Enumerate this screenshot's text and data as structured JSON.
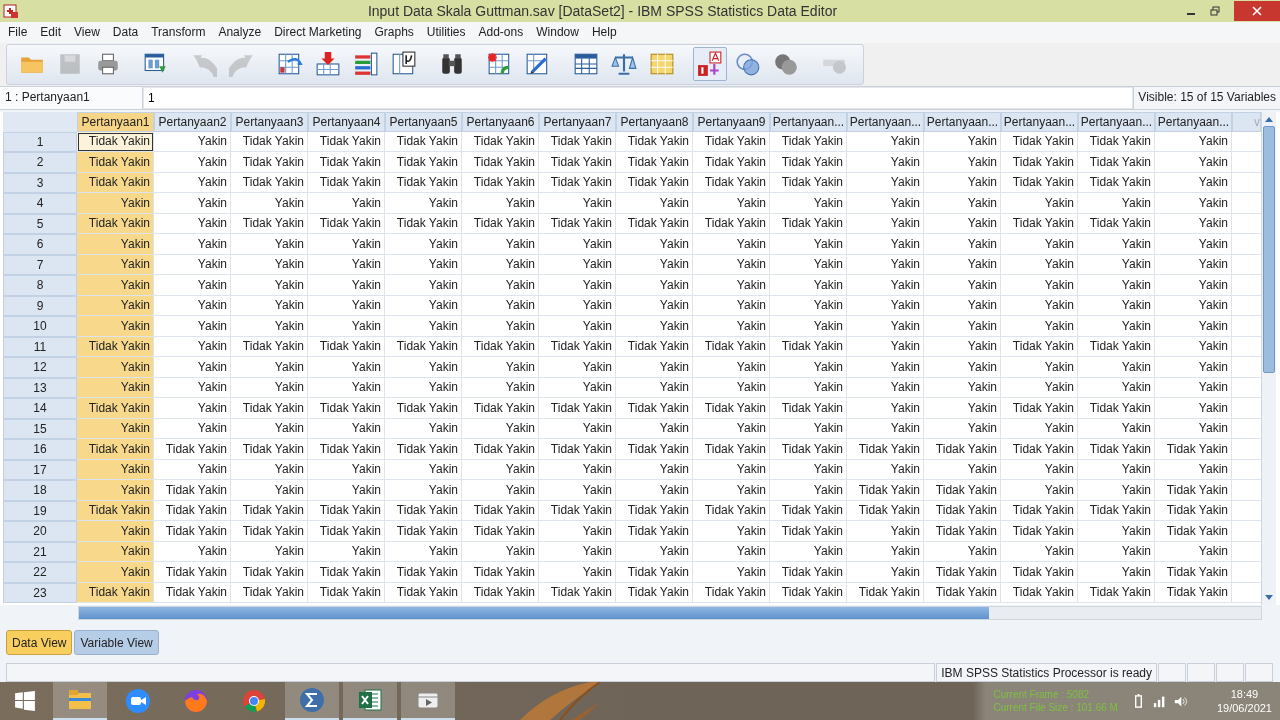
{
  "window": {
    "title": "Input Data Skala Guttman.sav [DataSet2] - IBM SPSS Statistics Data Editor"
  },
  "menu": [
    "File",
    "Edit",
    "View",
    "Data",
    "Transform",
    "Analyze",
    "Direct Marketing",
    "Graphs",
    "Utilities",
    "Add-ons",
    "Window",
    "Help"
  ],
  "toolbar": [
    {
      "disabled": false,
      "pressed": false
    },
    {
      "disabled": true,
      "pressed": false
    },
    {
      "disabled": false,
      "pressed": false
    },
    {
      "disabled": false,
      "pressed": false
    },
    {
      "disabled": true,
      "pressed": false
    },
    {
      "disabled": true,
      "pressed": false
    },
    {
      "disabled": false,
      "pressed": false
    },
    {
      "disabled": false,
      "pressed": false
    },
    {
      "disabled": false,
      "pressed": false
    },
    {
      "disabled": false,
      "pressed": false
    },
    {
      "disabled": false,
      "pressed": false
    },
    {
      "disabled": false,
      "pressed": false
    },
    {
      "disabled": false,
      "pressed": false
    },
    {
      "disabled": false,
      "pressed": false
    },
    {
      "disabled": false,
      "pressed": false
    },
    {
      "disabled": false,
      "pressed": false
    },
    {
      "disabled": false,
      "pressed": true
    },
    {
      "disabled": false,
      "pressed": false
    },
    {
      "disabled": false,
      "pressed": false
    },
    {
      "disabled": true,
      "pressed": false
    }
  ],
  "cell_editor": {
    "cell": "1 : Pertanyaan1",
    "value": "1",
    "visible": "Visible: 15 of 15 Variables"
  },
  "table": {
    "columns": [
      {
        "label": "Pertanyaan1",
        "selected": true
      },
      {
        "label": "Pertanyaan2",
        "selected": false
      },
      {
        "label": "Pertanyaan3",
        "selected": false
      },
      {
        "label": "Pertanyaan4",
        "selected": false
      },
      {
        "label": "Pertanyaan5",
        "selected": false
      },
      {
        "label": "Pertanyaan6",
        "selected": false
      },
      {
        "label": "Pertanyaan7",
        "selected": false
      },
      {
        "label": "Pertanyaan8",
        "selected": false
      },
      {
        "label": "Pertanyaan9",
        "selected": false
      },
      {
        "label": "Pertanyaan...",
        "selected": false
      },
      {
        "label": "Pertanyaan...",
        "selected": false
      },
      {
        "label": "Pertanyaan...",
        "selected": false
      },
      {
        "label": "Pertanyaan...",
        "selected": false
      },
      {
        "label": "Pertanyaan...",
        "selected": false
      },
      {
        "label": "Pertanyaan...",
        "selected": false
      }
    ],
    "empty_column": "v",
    "rows": [
      {
        "case": "1",
        "current": true,
        "cells": [
          "Tidak Yakin",
          "Yakin",
          "Tidak Yakin",
          "Tidak Yakin",
          "Tidak Yakin",
          "Tidak Yakin",
          "Tidak Yakin",
          "Tidak Yakin",
          "Tidak Yakin",
          "Tidak Yakin",
          "Yakin",
          "Yakin",
          "Tidak Yakin",
          "Tidak Yakin",
          "Yakin"
        ]
      },
      {
        "case": "2",
        "current": false,
        "cells": [
          "Tidak Yakin",
          "Yakin",
          "Tidak Yakin",
          "Tidak Yakin",
          "Tidak Yakin",
          "Tidak Yakin",
          "Tidak Yakin",
          "Tidak Yakin",
          "Tidak Yakin",
          "Tidak Yakin",
          "Yakin",
          "Yakin",
          "Tidak Yakin",
          "Tidak Yakin",
          "Yakin"
        ]
      },
      {
        "case": "3",
        "current": false,
        "cells": [
          "Tidak Yakin",
          "Yakin",
          "Tidak Yakin",
          "Tidak Yakin",
          "Tidak Yakin",
          "Tidak Yakin",
          "Tidak Yakin",
          "Tidak Yakin",
          "Tidak Yakin",
          "Tidak Yakin",
          "Yakin",
          "Yakin",
          "Tidak Yakin",
          "Tidak Yakin",
          "Yakin"
        ]
      },
      {
        "case": "4",
        "current": false,
        "cells": [
          "Yakin",
          "Yakin",
          "Yakin",
          "Yakin",
          "Yakin",
          "Yakin",
          "Yakin",
          "Yakin",
          "Yakin",
          "Yakin",
          "Yakin",
          "Yakin",
          "Yakin",
          "Yakin",
          "Yakin"
        ]
      },
      {
        "case": "5",
        "current": false,
        "cells": [
          "Tidak Yakin",
          "Yakin",
          "Tidak Yakin",
          "Tidak Yakin",
          "Tidak Yakin",
          "Tidak Yakin",
          "Tidak Yakin",
          "Tidak Yakin",
          "Tidak Yakin",
          "Tidak Yakin",
          "Yakin",
          "Yakin",
          "Tidak Yakin",
          "Tidak Yakin",
          "Yakin"
        ]
      },
      {
        "case": "6",
        "current": false,
        "cells": [
          "Yakin",
          "Yakin",
          "Yakin",
          "Yakin",
          "Yakin",
          "Yakin",
          "Yakin",
          "Yakin",
          "Yakin",
          "Yakin",
          "Yakin",
          "Yakin",
          "Yakin",
          "Yakin",
          "Yakin"
        ]
      },
      {
        "case": "7",
        "current": false,
        "cells": [
          "Yakin",
          "Yakin",
          "Yakin",
          "Yakin",
          "Yakin",
          "Yakin",
          "Yakin",
          "Yakin",
          "Yakin",
          "Yakin",
          "Yakin",
          "Yakin",
          "Yakin",
          "Yakin",
          "Yakin"
        ]
      },
      {
        "case": "8",
        "current": false,
        "cells": [
          "Yakin",
          "Yakin",
          "Yakin",
          "Yakin",
          "Yakin",
          "Yakin",
          "Yakin",
          "Yakin",
          "Yakin",
          "Yakin",
          "Yakin",
          "Yakin",
          "Yakin",
          "Yakin",
          "Yakin"
        ]
      },
      {
        "case": "9",
        "current": false,
        "cells": [
          "Yakin",
          "Yakin",
          "Yakin",
          "Yakin",
          "Yakin",
          "Yakin",
          "Yakin",
          "Yakin",
          "Yakin",
          "Yakin",
          "Yakin",
          "Yakin",
          "Yakin",
          "Yakin",
          "Yakin"
        ]
      },
      {
        "case": "10",
        "current": false,
        "cells": [
          "Yakin",
          "Yakin",
          "Yakin",
          "Yakin",
          "Yakin",
          "Yakin",
          "Yakin",
          "Yakin",
          "Yakin",
          "Yakin",
          "Yakin",
          "Yakin",
          "Yakin",
          "Yakin",
          "Yakin"
        ]
      },
      {
        "case": "11",
        "current": false,
        "cells": [
          "Tidak Yakin",
          "Yakin",
          "Tidak Yakin",
          "Tidak Yakin",
          "Tidak Yakin",
          "Tidak Yakin",
          "Tidak Yakin",
          "Tidak Yakin",
          "Tidak Yakin",
          "Tidak Yakin",
          "Yakin",
          "Yakin",
          "Tidak Yakin",
          "Tidak Yakin",
          "Yakin"
        ]
      },
      {
        "case": "12",
        "current": false,
        "cells": [
          "Yakin",
          "Yakin",
          "Yakin",
          "Yakin",
          "Yakin",
          "Yakin",
          "Yakin",
          "Yakin",
          "Yakin",
          "Yakin",
          "Yakin",
          "Yakin",
          "Yakin",
          "Yakin",
          "Yakin"
        ]
      },
      {
        "case": "13",
        "current": false,
        "cells": [
          "Yakin",
          "Yakin",
          "Yakin",
          "Yakin",
          "Yakin",
          "Yakin",
          "Yakin",
          "Yakin",
          "Yakin",
          "Yakin",
          "Yakin",
          "Yakin",
          "Yakin",
          "Yakin",
          "Yakin"
        ]
      },
      {
        "case": "14",
        "current": false,
        "cells": [
          "Tidak Yakin",
          "Yakin",
          "Tidak Yakin",
          "Tidak Yakin",
          "Tidak Yakin",
          "Tidak Yakin",
          "Tidak Yakin",
          "Tidak Yakin",
          "Tidak Yakin",
          "Tidak Yakin",
          "Yakin",
          "Yakin",
          "Tidak Yakin",
          "Tidak Yakin",
          "Yakin"
        ]
      },
      {
        "case": "15",
        "current": false,
        "cells": [
          "Yakin",
          "Yakin",
          "Yakin",
          "Yakin",
          "Yakin",
          "Yakin",
          "Yakin",
          "Yakin",
          "Yakin",
          "Yakin",
          "Yakin",
          "Yakin",
          "Yakin",
          "Yakin",
          "Yakin"
        ]
      },
      {
        "case": "16",
        "current": false,
        "cells": [
          "Tidak Yakin",
          "Tidak Yakin",
          "Tidak Yakin",
          "Tidak Yakin",
          "Tidak Yakin",
          "Tidak Yakin",
          "Tidak Yakin",
          "Tidak Yakin",
          "Tidak Yakin",
          "Tidak Yakin",
          "Tidak Yakin",
          "Tidak Yakin",
          "Tidak Yakin",
          "Tidak Yakin",
          "Tidak Yakin"
        ]
      },
      {
        "case": "17",
        "current": false,
        "cells": [
          "Yakin",
          "Yakin",
          "Yakin",
          "Yakin",
          "Yakin",
          "Yakin",
          "Yakin",
          "Yakin",
          "Yakin",
          "Yakin",
          "Yakin",
          "Yakin",
          "Yakin",
          "Yakin",
          "Yakin"
        ]
      },
      {
        "case": "18",
        "current": false,
        "cells": [
          "Yakin",
          "Tidak Yakin",
          "Yakin",
          "Yakin",
          "Yakin",
          "Yakin",
          "Yakin",
          "Yakin",
          "Yakin",
          "Yakin",
          "Tidak Yakin",
          "Tidak Yakin",
          "Yakin",
          "Yakin",
          "Tidak Yakin"
        ]
      },
      {
        "case": "19",
        "current": false,
        "cells": [
          "Tidak Yakin",
          "Tidak Yakin",
          "Tidak Yakin",
          "Tidak Yakin",
          "Tidak Yakin",
          "Tidak Yakin",
          "Tidak Yakin",
          "Tidak Yakin",
          "Tidak Yakin",
          "Tidak Yakin",
          "Tidak Yakin",
          "Tidak Yakin",
          "Tidak Yakin",
          "Tidak Yakin",
          "Tidak Yakin"
        ]
      },
      {
        "case": "20",
        "current": false,
        "cells": [
          "Yakin",
          "Tidak Yakin",
          "Tidak Yakin",
          "Tidak Yakin",
          "Tidak Yakin",
          "Tidak Yakin",
          "Yakin",
          "Tidak Yakin",
          "Yakin",
          "Tidak Yakin",
          "Yakin",
          "Tidak Yakin",
          "Tidak Yakin",
          "Yakin",
          "Tidak Yakin"
        ]
      },
      {
        "case": "21",
        "current": false,
        "cells": [
          "Yakin",
          "Yakin",
          "Yakin",
          "Yakin",
          "Yakin",
          "Yakin",
          "Yakin",
          "Yakin",
          "Yakin",
          "Yakin",
          "Yakin",
          "Yakin",
          "Yakin",
          "Yakin",
          "Yakin"
        ]
      },
      {
        "case": "22",
        "current": false,
        "cells": [
          "Yakin",
          "Tidak Yakin",
          "Tidak Yakin",
          "Tidak Yakin",
          "Tidak Yakin",
          "Tidak Yakin",
          "Yakin",
          "Tidak Yakin",
          "Yakin",
          "Tidak Yakin",
          "Yakin",
          "Tidak Yakin",
          "Tidak Yakin",
          "Yakin",
          "Tidak Yakin"
        ]
      },
      {
        "case": "23",
        "current": false,
        "cells": [
          "Tidak Yakin",
          "Tidak Yakin",
          "Tidak Yakin",
          "Tidak Yakin",
          "Tidak Yakin",
          "Tidak Yakin",
          "Tidak Yakin",
          "Tidak Yakin",
          "Tidak Yakin",
          "Tidak Yakin",
          "Tidak Yakin",
          "Tidak Yakin",
          "Tidak Yakin",
          "Tidak Yakin",
          "Tidak Yakin"
        ]
      }
    ]
  },
  "view_tabs": [
    {
      "label": "Data View",
      "selected": true
    },
    {
      "label": "Variable View",
      "selected": false
    }
  ],
  "status_bar": {
    "message": "IBM SPSS Statistics Processor is ready"
  },
  "taskbar": {
    "apps": [
      {
        "running": true
      },
      {
        "running": false
      },
      {
        "running": false
      },
      {
        "running": false
      },
      {
        "running": true
      },
      {
        "running": true
      },
      {
        "running": true
      }
    ],
    "overlay": [
      "Current Frame : 5082",
      "Current File Size : 101.66 M"
    ],
    "time": "18:49",
    "date": "19/06/2021"
  }
}
